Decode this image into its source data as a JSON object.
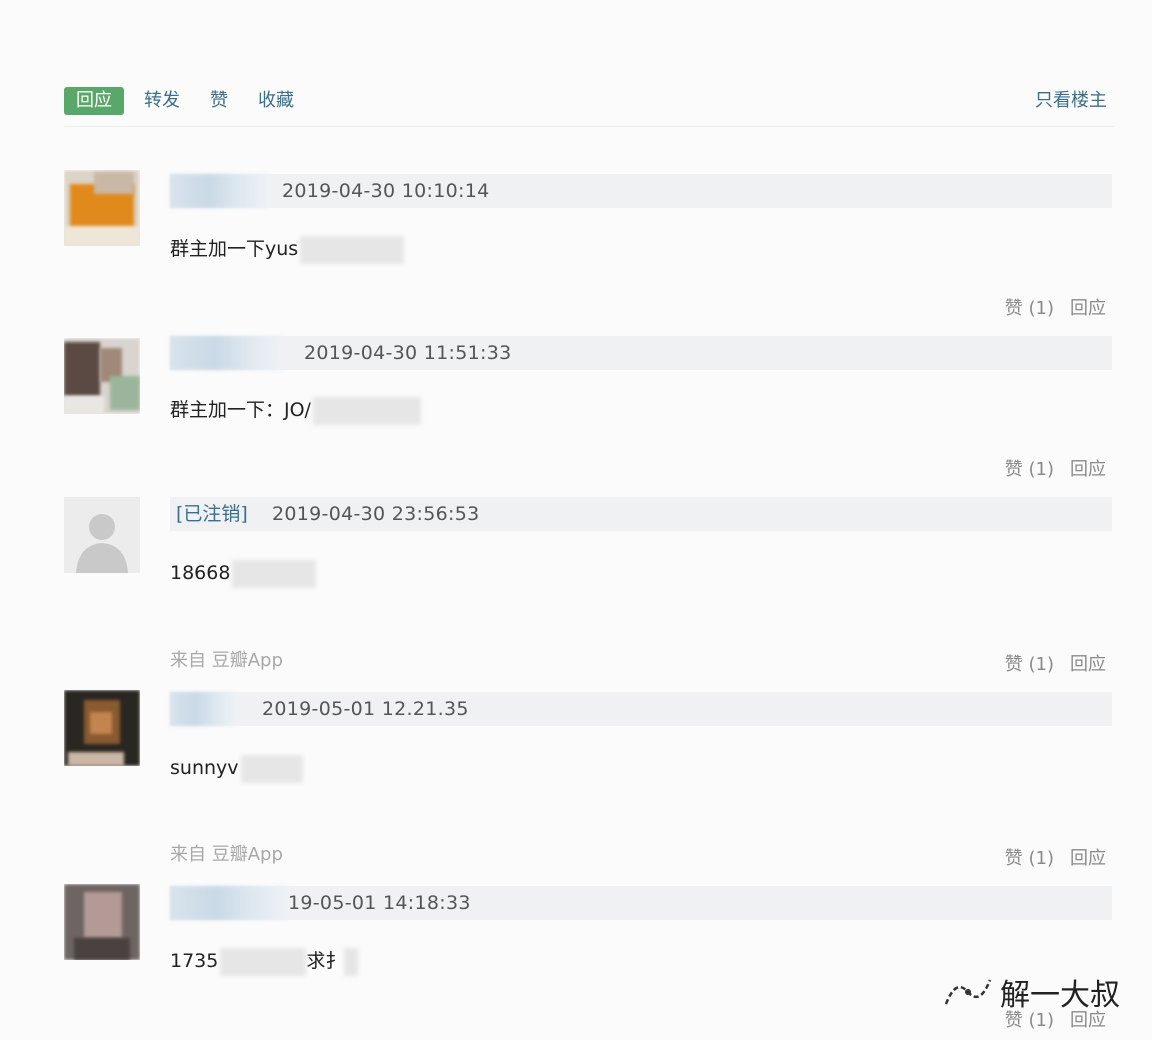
{
  "toolbar": {
    "tabs": [
      "回应",
      "转发",
      "赞",
      "收藏"
    ],
    "only_op": "只看楼主"
  },
  "comments": [
    {
      "deleted_tag": "",
      "timestamp": "2019-04-30 10:10:14",
      "content_visible": "群主加一下yus",
      "like_label": "赞 (1)",
      "reply_label": "回应",
      "source": ""
    },
    {
      "deleted_tag": "",
      "timestamp": "2019-04-30 11:51:33",
      "content_visible": "群主加一下：JO/",
      "like_label": "赞 (1)",
      "reply_label": "回应",
      "source": ""
    },
    {
      "deleted_tag": "[已注销]",
      "timestamp": "2019-04-30 23:56:53",
      "content_visible": "18668",
      "like_label": "赞 (1)",
      "reply_label": "回应",
      "source": "来自 豆瓣App"
    },
    {
      "deleted_tag": "",
      "timestamp": "2019-05-01 12.21.35",
      "content_visible": "sunnyv",
      "like_label": "赞 (1)",
      "reply_label": "回应",
      "source": "来自 豆瓣App"
    },
    {
      "deleted_tag": "",
      "timestamp": "19-05-01 14:18:33",
      "content_visible": "1735",
      "content_tail": "求扌",
      "like_label": "赞 (1)",
      "reply_label": "回应",
      "source": ""
    }
  ],
  "watermark": {
    "text": "解一大叔",
    "icon": "wechat-channel-icon"
  },
  "colors": {
    "accent_green": "#5aa76a",
    "link_blue": "#3a6e8f",
    "header_bg": "#f0f1f3"
  }
}
